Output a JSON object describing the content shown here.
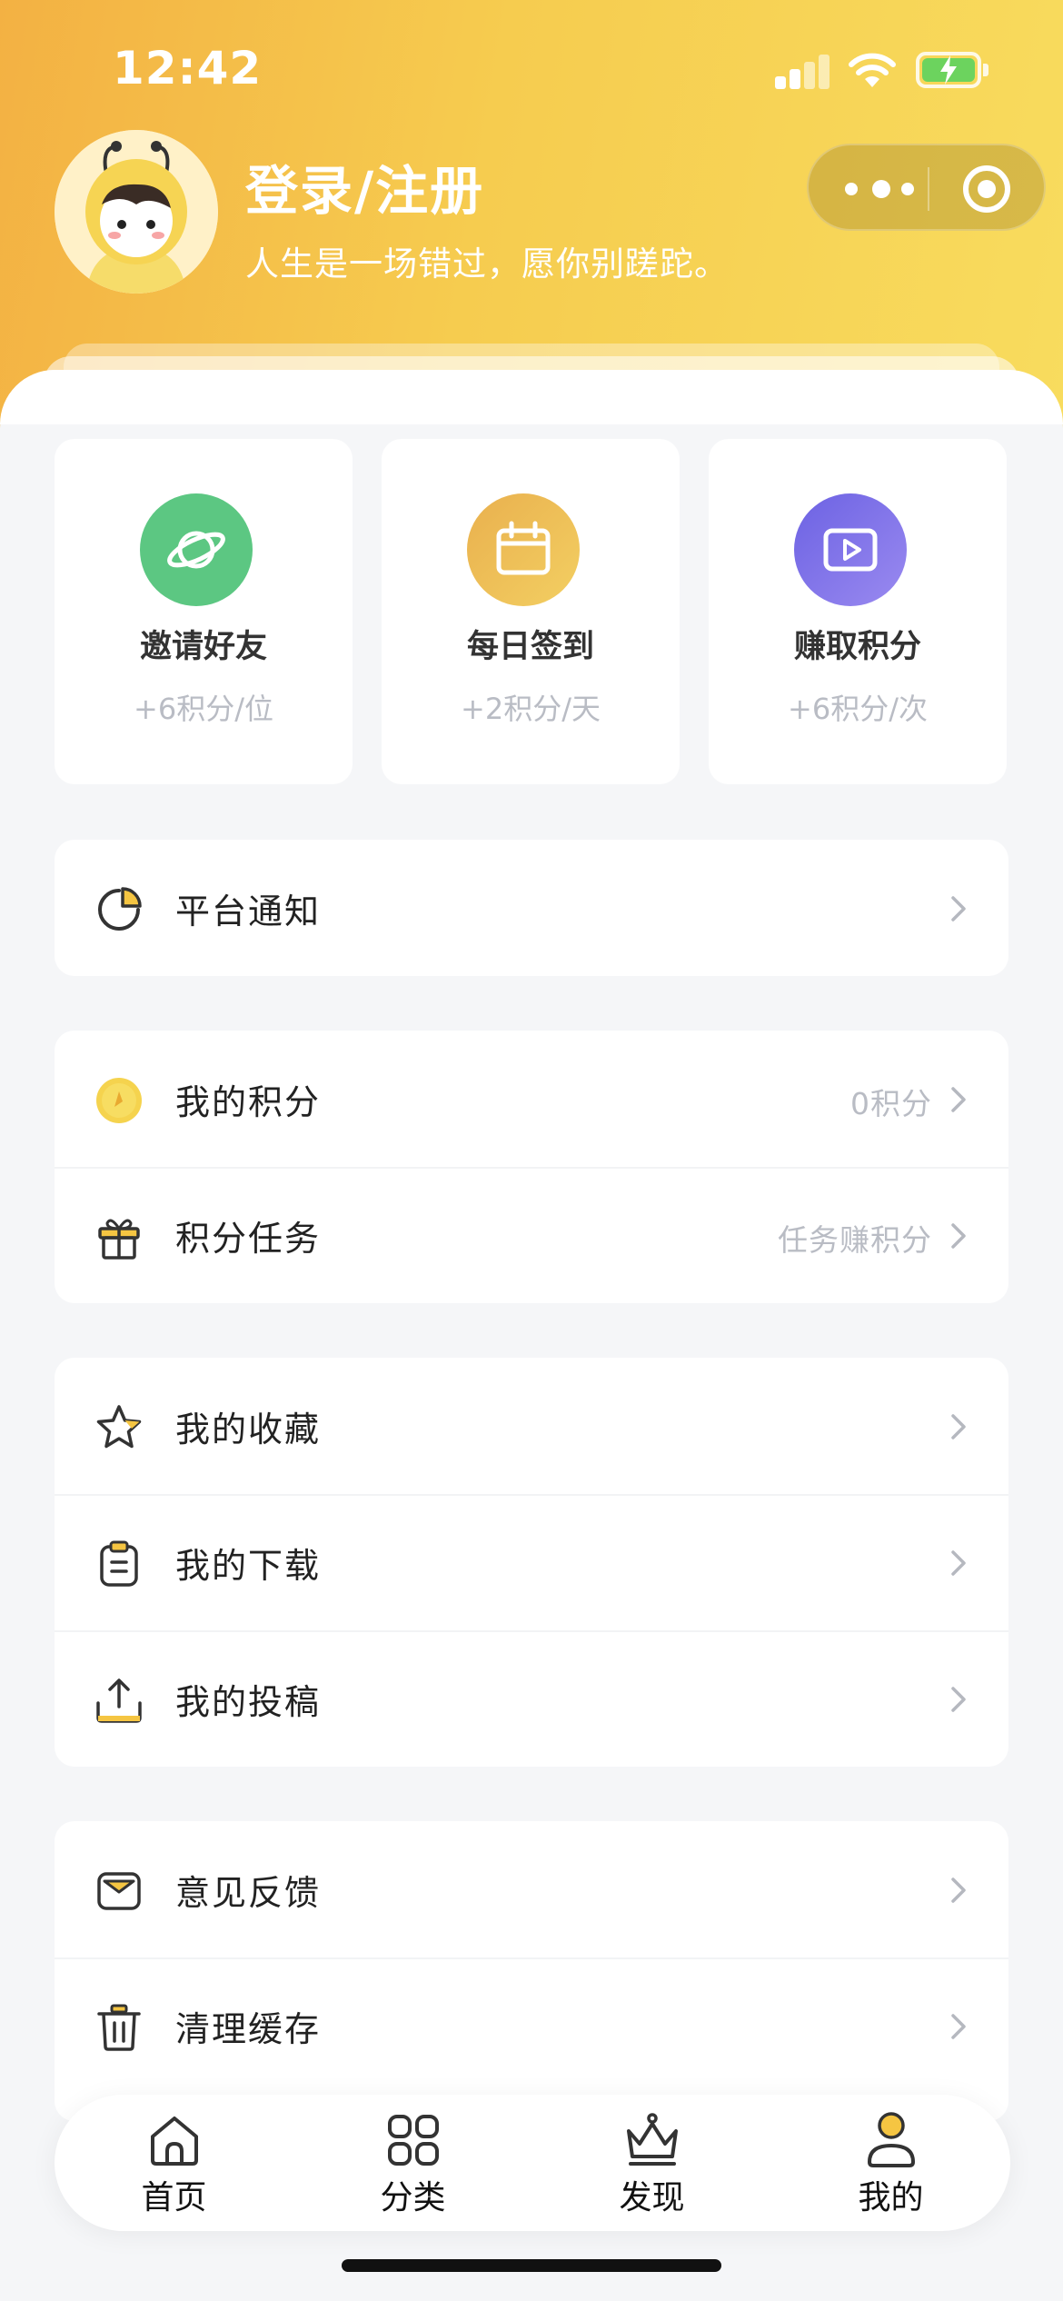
{
  "status_bar": {
    "time": "12:42"
  },
  "profile": {
    "title": "登录/注册",
    "subtitle": "人生是一场错过，愿你别蹉跎。"
  },
  "quick_actions": [
    {
      "label": "邀请好友",
      "reward": "+6积分/位",
      "icon": "planet-icon",
      "color": "#5cc782"
    },
    {
      "label": "每日签到",
      "reward": "+2积分/天",
      "icon": "calendar-icon",
      "color": "#ecb84e"
    },
    {
      "label": "赚取积分",
      "reward": "+6积分/次",
      "icon": "video-play-icon",
      "color": "#7b6ee6"
    }
  ],
  "menu": {
    "notice": {
      "label": "平台通知"
    },
    "points": {
      "label": "我的积分",
      "value": "0积分"
    },
    "tasks": {
      "label": "积分任务",
      "value": "任务赚积分"
    },
    "favorites": {
      "label": "我的收藏"
    },
    "downloads": {
      "label": "我的下载"
    },
    "submissions": {
      "label": "我的投稿"
    },
    "feedback": {
      "label": "意见反馈"
    },
    "clear_cache": {
      "label": "清理缓存"
    }
  },
  "tabbar": {
    "home": "首页",
    "category": "分类",
    "discover": "发现",
    "mine": "我的"
  },
  "colors": {
    "accent_yellow": "#f6cc4f",
    "icon_yellow": "#f5c542"
  }
}
